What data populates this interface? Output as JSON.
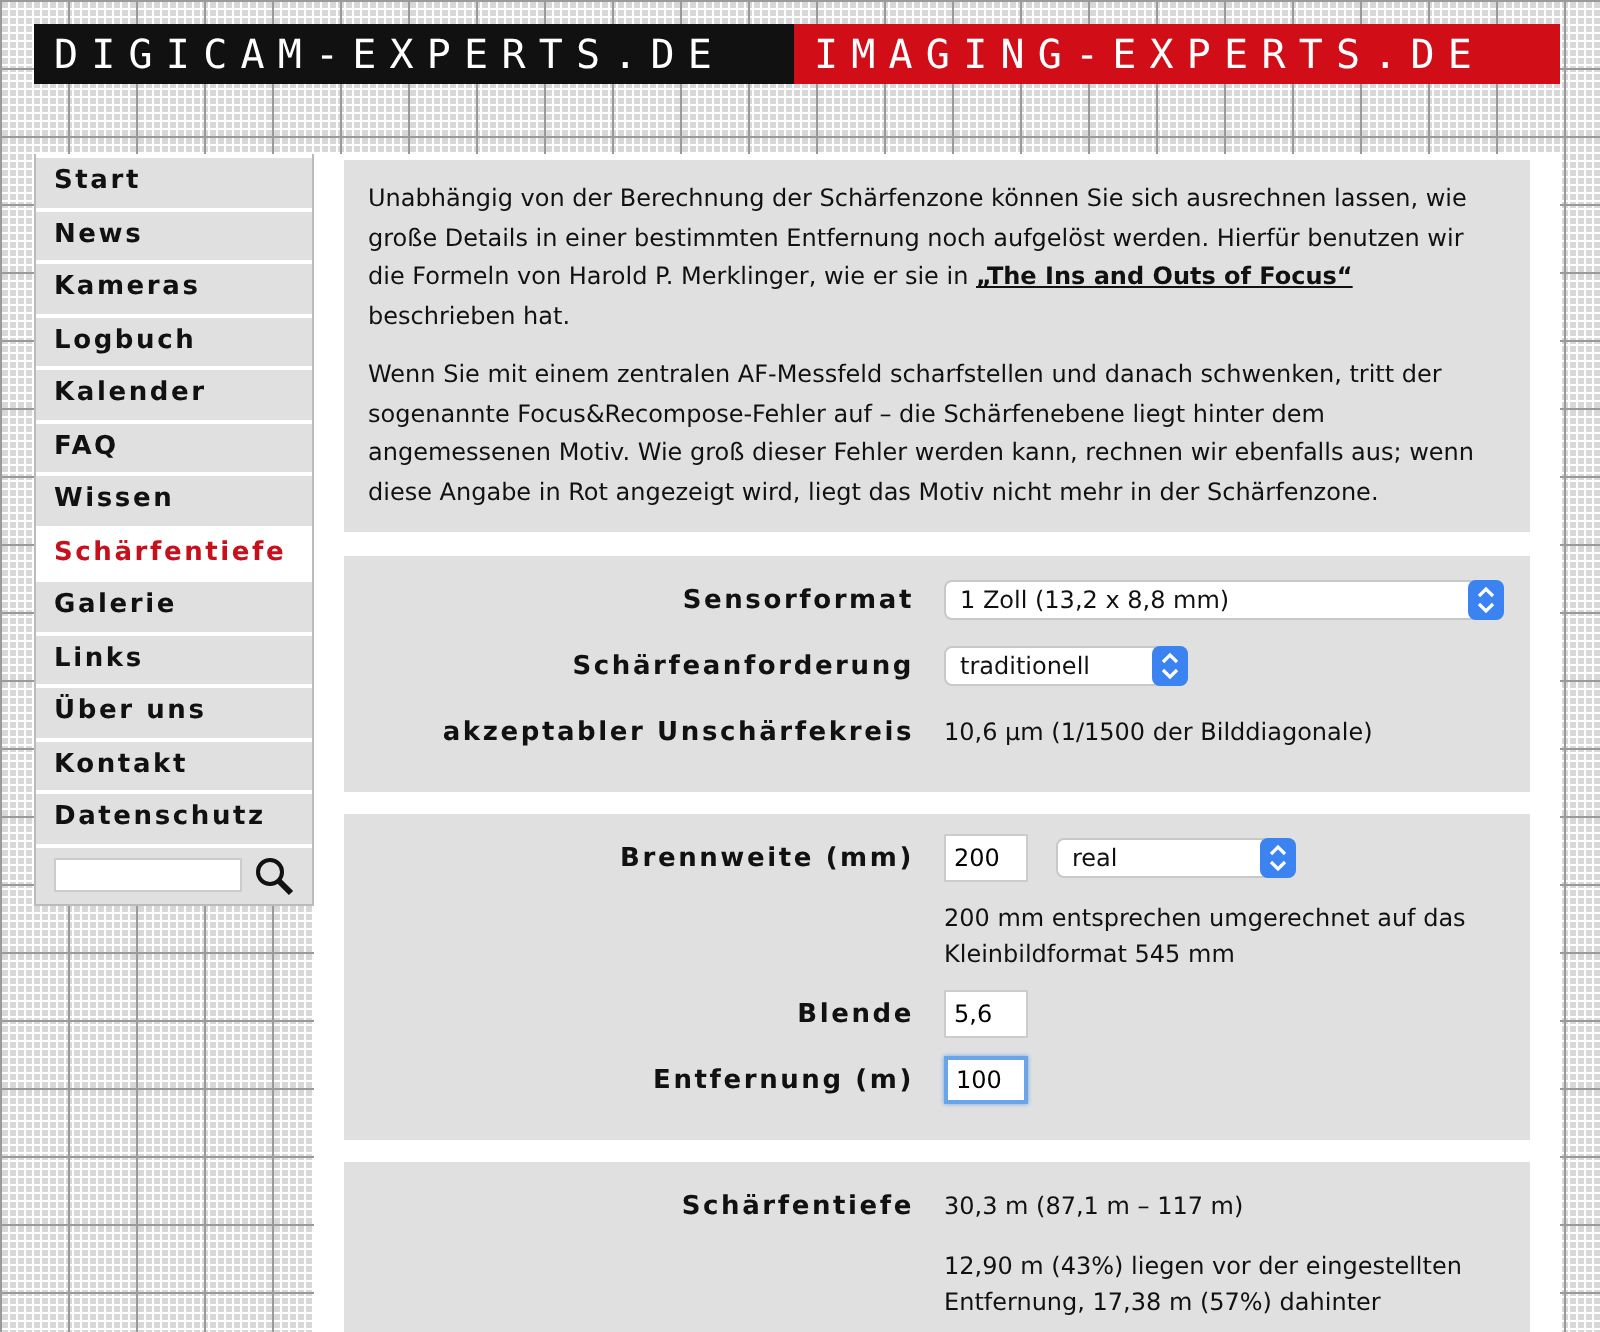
{
  "header": {
    "left": "DIGICAM-EXPERTS.DE",
    "right": "IMAGING-EXPERTS.DE"
  },
  "nav": {
    "items": [
      {
        "label": "Start",
        "selected": false
      },
      {
        "label": "News",
        "selected": false
      },
      {
        "label": "Kameras",
        "selected": false
      },
      {
        "label": "Logbuch",
        "selected": false
      },
      {
        "label": "Kalender",
        "selected": false
      },
      {
        "label": "FAQ",
        "selected": false
      },
      {
        "label": "Wissen",
        "selected": false
      },
      {
        "label": "Schärfentiefe",
        "selected": true
      },
      {
        "label": "Galerie",
        "selected": false
      },
      {
        "label": "Links",
        "selected": false
      },
      {
        "label": "Über uns",
        "selected": false
      },
      {
        "label": "Kontakt",
        "selected": false
      },
      {
        "label": "Datenschutz",
        "selected": false
      }
    ]
  },
  "intro": [
    {
      "text": "Unabhängig von der Berechnung der Schärfenzone können Sie sich ausrechnen lassen, wie große Details in einer bestimmten Entfernung noch aufgelöst werden. Hierfür benutzen wir die Formeln von Harold P. Merklinger, wie er sie in ",
      "link": "„The Ins and Outs of Focus“",
      "after": " beschrieben hat."
    },
    {
      "text": "Wenn Sie mit einem zentralen AF-Messfeld scharfstellen und danach schwenken, tritt der sogenannte Focus&Recompose-Fehler auf – die Schärfenebene liegt hinter dem angemessenen Motiv. Wie groß dieser Fehler werden kann, rechnen wir ebenfalls aus; wenn diese Angabe in Rot angezeigt wird, liegt das Motiv nicht mehr in der Schärfenzone."
    }
  ],
  "sections": [
    {
      "rows": [
        {
          "kind": "select",
          "label": "Sensorformat",
          "value": "1 Zoll (13,2 x 8,8 mm)",
          "wide": true
        },
        {
          "kind": "select",
          "label": "Schärfeanforderung",
          "value": "traditionell",
          "wide": false
        },
        {
          "kind": "text",
          "label": "akzeptabler Unschärfekreis",
          "value": "10,6 µm (1/1500 der Bilddiagonale)"
        }
      ]
    },
    {
      "rows": [
        {
          "kind": "input-select",
          "label": "Brennweite (mm)",
          "value": "200",
          "option": "real",
          "focused": false
        },
        {
          "kind": "note",
          "value": "200 mm entsprechen umgerechnet auf das Kleinbildformat 545 mm"
        },
        {
          "kind": "input",
          "label": "Blende",
          "value": "5,6",
          "focused": false
        },
        {
          "kind": "input",
          "label": "Entfernung (m)",
          "value": "100",
          "focused": true
        }
      ]
    },
    {
      "rows": [
        {
          "kind": "text",
          "label": "Schärfentiefe",
          "value": "30,3 m (87,1 m – 117 m)"
        },
        {
          "kind": "note",
          "value": "12,90 m (43%) liegen vor der eingestellten Entfernung, 17,38 m (57%) dahinter"
        }
      ]
    }
  ]
}
